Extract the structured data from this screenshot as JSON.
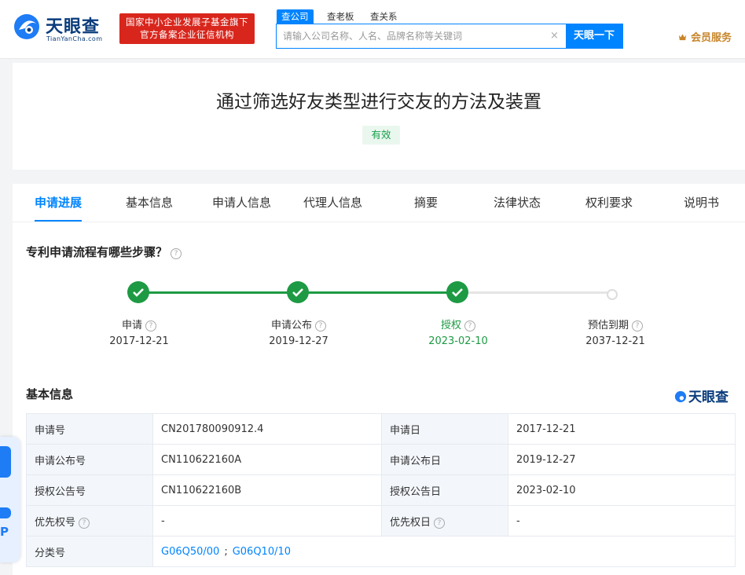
{
  "header": {
    "logo_cn": "天眼查",
    "logo_en": "TianYanCha.com",
    "banner_line1": "国家中小企业发展子基金旗下",
    "banner_line2": "官方备案企业征信机构",
    "search_tabs": [
      "查公司",
      "查老板",
      "查关系"
    ],
    "search_placeholder": "请输入公司名称、人名、品牌名称等关键词",
    "search_button": "天眼一下",
    "vip_label": "会员服务"
  },
  "patent": {
    "title": "通过筛选好友类型进行交友的方法及装置",
    "status": "有效"
  },
  "tabs": [
    "申请进展",
    "基本信息",
    "申请人信息",
    "代理人信息",
    "摘要",
    "法律状态",
    "权利要求",
    "说明书"
  ],
  "progress": {
    "heading": "专利申请流程有哪些步骤？",
    "steps": [
      {
        "label": "申请",
        "date": "2017-12-21",
        "state": "done"
      },
      {
        "label": "申请公布",
        "date": "2019-12-27",
        "state": "done"
      },
      {
        "label": "授权",
        "date": "2023-02-10",
        "state": "current"
      },
      {
        "label": "预估到期",
        "date": "2037-12-21",
        "state": "pending"
      }
    ]
  },
  "basic_info": {
    "heading": "基本信息",
    "brand": "天眼查",
    "rows": [
      {
        "k1": "申请号",
        "v1": "CN201780090912.4",
        "k2": "申请日",
        "v2": "2017-12-21"
      },
      {
        "k1": "申请公布号",
        "v1": "CN110622160A",
        "k2": "申请公布日",
        "v2": "2019-12-27"
      },
      {
        "k1": "授权公告号",
        "v1": "CN110622160B",
        "k2": "授权公告日",
        "v2": "2023-02-10"
      },
      {
        "k1": "优先权号",
        "v1": "-",
        "k2": "优先权日",
        "v2": "-"
      }
    ],
    "classification_label": "分类号",
    "classification": [
      "G06Q50/00",
      "G06Q10/10"
    ],
    "classification_sep": ";"
  },
  "side_float": {
    "text1": "P"
  },
  "colors": {
    "primary": "#0084ff",
    "success": "#1d9a43",
    "banner": "#d9261c",
    "brand": "#0a3c7c"
  }
}
